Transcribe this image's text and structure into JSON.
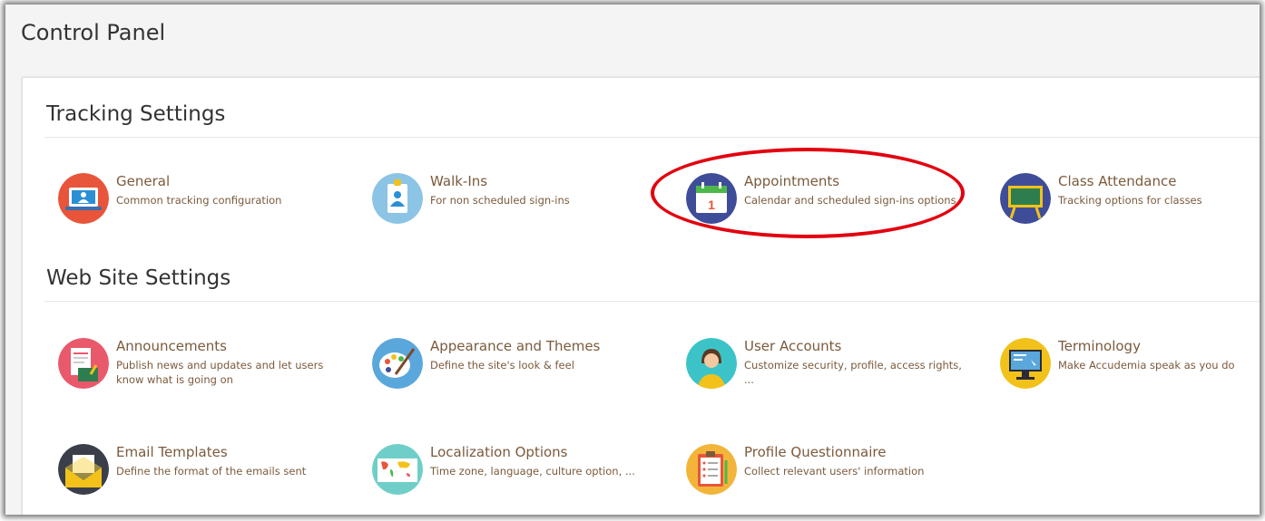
{
  "header": {
    "title": "Control Panel"
  },
  "sections": [
    {
      "title": "Tracking Settings",
      "items": [
        {
          "title": "General",
          "desc": "Common tracking configuration",
          "icon": "laptop-user-icon"
        },
        {
          "title": "Walk-Ins",
          "desc": "For non scheduled sign-ins",
          "icon": "id-badge-icon"
        },
        {
          "title": "Appointments",
          "desc": "Calendar and scheduled sign-ins options",
          "icon": "calendar-icon"
        },
        {
          "title": "Class Attendance",
          "desc": "Tracking options for classes",
          "icon": "chalkboard-icon"
        }
      ]
    },
    {
      "title": "Web Site Settings",
      "items": [
        {
          "title": "Announcements",
          "desc": "Publish news and updates and let users know what is going on",
          "icon": "announcement-icon"
        },
        {
          "title": "Appearance and Themes",
          "desc": "Define the site's look & feel",
          "icon": "paint-palette-icon"
        },
        {
          "title": "User Accounts",
          "desc": "Customize security, profile, access rights, ...",
          "icon": "user-avatar-icon"
        },
        {
          "title": "Terminology",
          "desc": "Make Accudemia speak as you do",
          "icon": "monitor-icon"
        },
        {
          "title": "Email Templates",
          "desc": "Define the format of the emails sent",
          "icon": "envelope-icon"
        },
        {
          "title": "Localization Options",
          "desc": "Time zone, language, culture option, ...",
          "icon": "world-map-icon"
        },
        {
          "title": "Profile Questionnaire",
          "desc": "Collect relevant users' information",
          "icon": "clipboard-icon"
        }
      ]
    }
  ],
  "colors": {
    "highlight": "#e3000f",
    "tile_text": "#7b5a3c"
  }
}
